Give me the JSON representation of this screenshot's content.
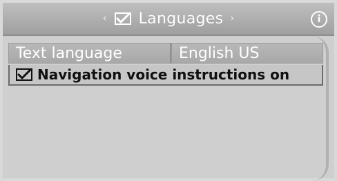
{
  "header": {
    "title": "Languages",
    "left_arrow": "‹",
    "right_arrow": "›",
    "title_icon": "checkmark-square-icon",
    "info_icon_text": "i"
  },
  "settings": {
    "text_language_label": "Text language",
    "text_language_value": "English US",
    "nav_voice_label": "Navigation voice instructions on",
    "nav_voice_checked": true
  },
  "colors": {
    "background": "#d9d9d9",
    "header": "#a8a8a8",
    "text_light": "#ffffff",
    "text_dark": "#101010",
    "selection_border": "#6b6b6b"
  }
}
